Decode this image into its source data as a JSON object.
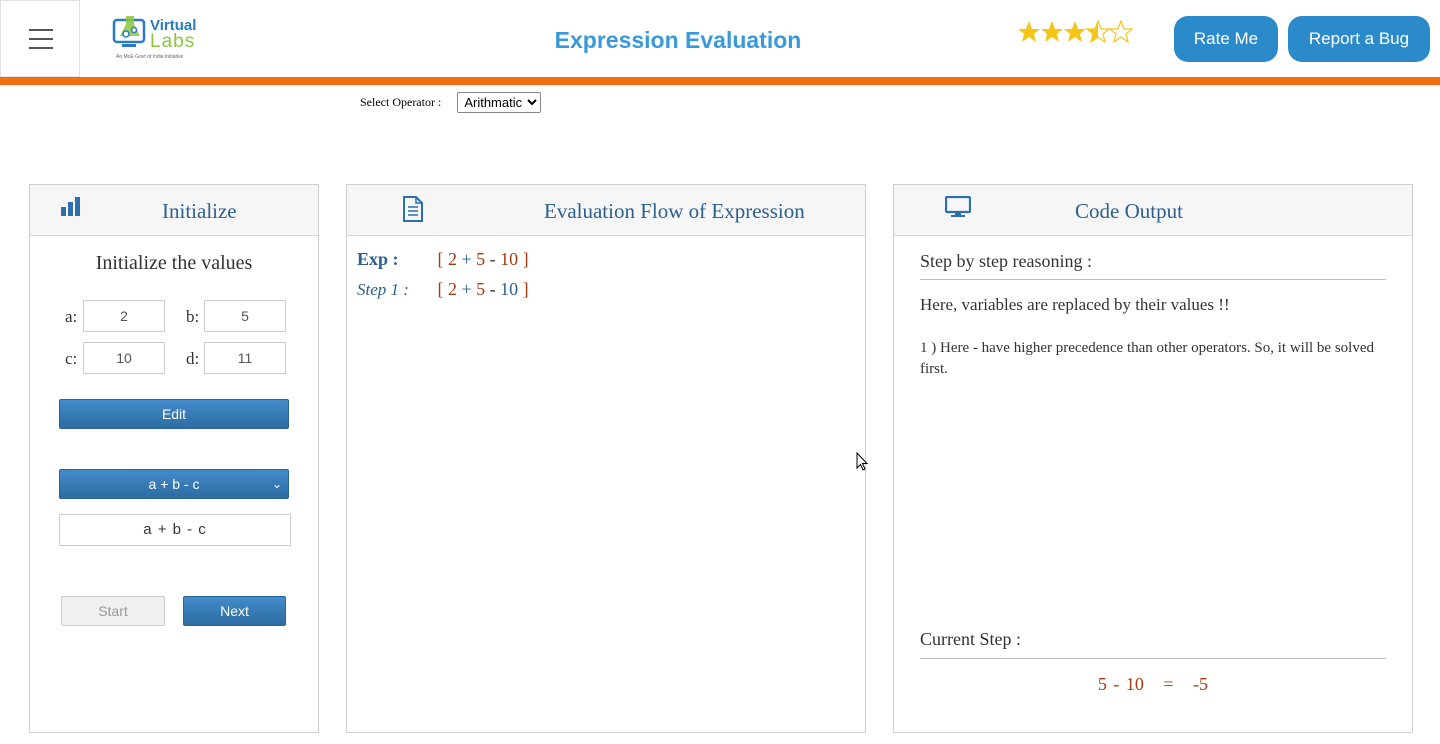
{
  "header": {
    "logo": {
      "line1": "Virtual",
      "line2": "Labs",
      "tagline": "An MoE Govt of India Initiative"
    },
    "title": "Expression Evaluation",
    "rating": 3.5,
    "rate_label": "Rate Me",
    "bug_label": "Report a Bug"
  },
  "colors": {
    "accent": "#2b8ac9",
    "orange_bar": "#f16e11",
    "panel_title": "#2c5f8d",
    "value": "#a33a10"
  },
  "operator": {
    "label": "Select Operator :",
    "selected": "Arithmatic"
  },
  "initialize": {
    "title": "Initialize",
    "icon": "bar-chart-icon",
    "heading": "Initialize the values",
    "vars": [
      {
        "label": "a:",
        "value": "2"
      },
      {
        "label": "b:",
        "value": "5"
      },
      {
        "label": "c:",
        "value": "10"
      },
      {
        "label": "d:",
        "value": "11"
      }
    ],
    "edit_label": "Edit",
    "expression_selected": "a + b - c",
    "expression_display": "a + b - c",
    "start_label": "Start",
    "next_label": "Next"
  },
  "flow": {
    "title": "Evaluation Flow of Expression",
    "icon": "document-icon",
    "exp_label": "Exp :",
    "step_label": "Step 1 :",
    "exp_tokens": [
      "[",
      "2",
      "+",
      "5",
      "-",
      "10",
      "]"
    ],
    "step_tokens": [
      "[",
      "2",
      "+",
      "5",
      "-",
      "10",
      "]"
    ]
  },
  "output": {
    "title": "Code Output",
    "icon": "monitor-icon",
    "reasoning_label": "Step by step reasoning :",
    "reasoning_line1": "Here, variables are replaced by their values !!",
    "reasoning_line2": "1 ) Here - have higher precedence than other operators. So, it will be solved first.",
    "current_label": "Current Step :",
    "current_calc": "5 - 10   =   -5"
  }
}
